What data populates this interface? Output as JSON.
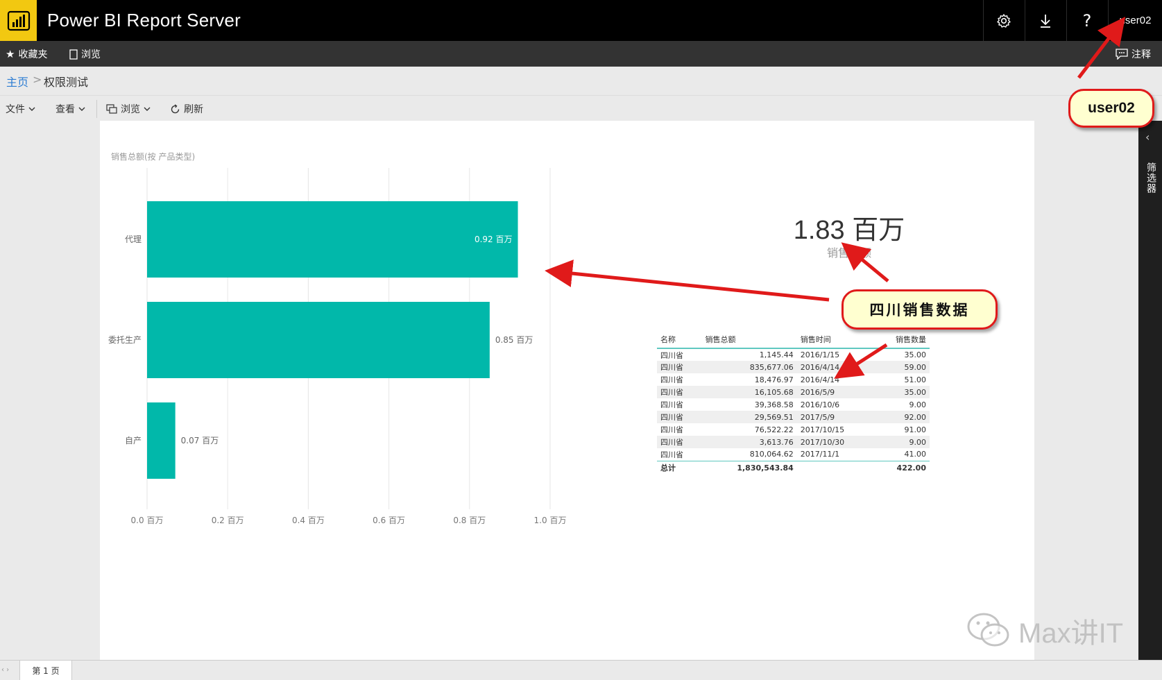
{
  "header": {
    "app_title": "Power BI Report Server",
    "user": "user02",
    "icons": [
      "settings-icon",
      "download-icon",
      "help-icon"
    ],
    "help_glyph": "?"
  },
  "navbar": {
    "favorites": "收藏夹",
    "browse": "浏览",
    "comments": "注释"
  },
  "breadcrumb": {
    "home": "主页",
    "separator": ">",
    "current": "权限测试"
  },
  "toolbar": {
    "file": "文件",
    "view": "查看",
    "browse": "浏览",
    "refresh": "刷新"
  },
  "kpi": {
    "value": "1.83 百万",
    "label": "销售总额"
  },
  "chart_data": {
    "type": "bar",
    "orientation": "horizontal",
    "title": "销售总额(按 产品类型)",
    "categories": [
      "代理",
      "委托生产",
      "自产"
    ],
    "values": [
      0.92,
      0.85,
      0.07
    ],
    "data_labels": [
      "0.92 百万",
      "0.85 百万",
      "0.07 百万"
    ],
    "xlim": [
      0,
      1.0
    ],
    "xticks": [
      "0.0 百万",
      "0.2 百万",
      "0.4 百万",
      "0.6 百万",
      "0.8 百万",
      "1.0 百万"
    ],
    "grid": true,
    "bar_color": "#01b8aa"
  },
  "table": {
    "headers": [
      "名称",
      "销售总额",
      "销售时间",
      "销售数量"
    ],
    "rows": [
      [
        "四川省",
        "1,145.44",
        "2016/1/15",
        "35.00"
      ],
      [
        "四川省",
        "835,677.06",
        "2016/4/14",
        "59.00"
      ],
      [
        "四川省",
        "18,476.97",
        "2016/4/14",
        "51.00"
      ],
      [
        "四川省",
        "16,105.68",
        "2016/5/9",
        "35.00"
      ],
      [
        "四川省",
        "39,368.58",
        "2016/10/6",
        "9.00"
      ],
      [
        "四川省",
        "29,569.51",
        "2017/5/9",
        "92.00"
      ],
      [
        "四川省",
        "76,522.22",
        "2017/10/15",
        "91.00"
      ],
      [
        "四川省",
        "3,613.76",
        "2017/10/30",
        "9.00"
      ],
      [
        "四川省",
        "810,064.62",
        "2017/11/1",
        "41.00"
      ]
    ],
    "total": [
      "总计",
      "1,830,543.84",
      "",
      "422.00"
    ]
  },
  "filters": {
    "label": "筛选器"
  },
  "pages": {
    "tab": "第 1 页"
  },
  "annotations": {
    "user_callout": "user02",
    "data_callout": "四川销售数据",
    "arrow_color": "#e01a1a"
  },
  "watermark": "Max讲IT"
}
